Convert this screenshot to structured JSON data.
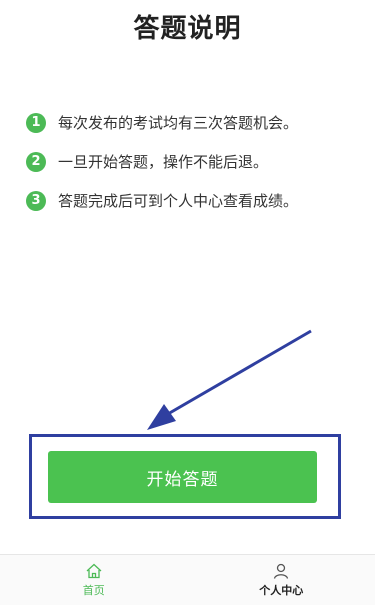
{
  "page": {
    "title": "答题说明"
  },
  "rules": [
    {
      "num": "1",
      "text": "每次发布的考试均有三次答题机会。"
    },
    {
      "num": "2",
      "text": "一旦开始答题，操作不能后退。"
    },
    {
      "num": "3",
      "text": "答题完成后可到个人中心查看成绩。"
    }
  ],
  "start_button": {
    "label": "开始答题"
  },
  "tabbar": {
    "items": [
      {
        "label": "首页",
        "icon": "home-icon",
        "active": true
      },
      {
        "label": "个人中心",
        "icon": "person-icon",
        "active": false
      }
    ]
  },
  "colors": {
    "accent": "#4bc250",
    "annotation": "#2f3fa0"
  }
}
